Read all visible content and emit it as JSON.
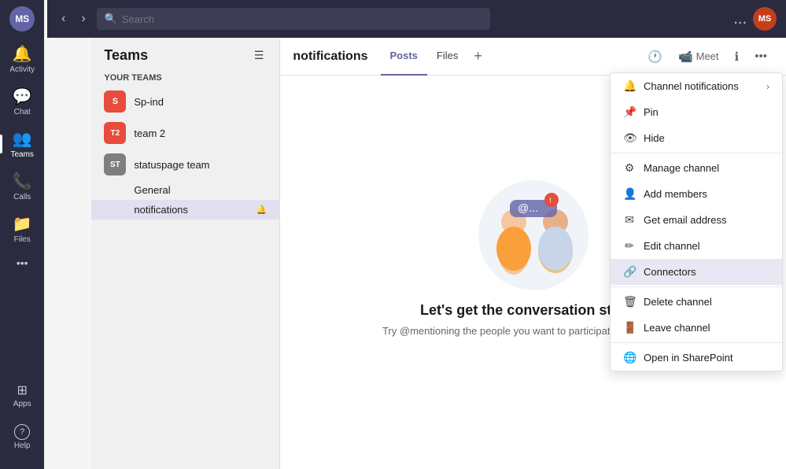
{
  "app": {
    "title": "Teams"
  },
  "topbar": {
    "search_placeholder": "Search",
    "dots_label": "...",
    "user_initials": "MS"
  },
  "sidebar": {
    "items": [
      {
        "id": "activity",
        "label": "Activity",
        "icon": "🔔"
      },
      {
        "id": "chat",
        "label": "Chat",
        "icon": "💬"
      },
      {
        "id": "teams",
        "label": "Teams",
        "icon": "👥"
      },
      {
        "id": "calls",
        "label": "Calls",
        "icon": "📞"
      },
      {
        "id": "files",
        "label": "Files",
        "icon": "📁"
      },
      {
        "id": "more",
        "label": "",
        "icon": "•••"
      }
    ],
    "bottom": [
      {
        "id": "apps",
        "label": "Apps",
        "icon": "⊞"
      },
      {
        "id": "help",
        "label": "Help",
        "icon": "?"
      }
    ]
  },
  "teams_panel": {
    "title": "Teams",
    "your_teams_label": "Your teams",
    "teams": [
      {
        "id": "sp-ind",
        "name": "Sp-ind",
        "initials": "S",
        "color": "#e74c3c",
        "channels": []
      },
      {
        "id": "team2",
        "name": "team 2",
        "initials": "T2",
        "color": "#e74c3c",
        "channels": []
      },
      {
        "id": "statuspage",
        "name": "statuspage team",
        "initials": "ST",
        "color": "#7e7e7e",
        "channels": [
          {
            "id": "general",
            "name": "General",
            "active": false
          },
          {
            "id": "notifications",
            "name": "notifications",
            "active": true,
            "has_icon": true
          }
        ]
      }
    ]
  },
  "channel": {
    "name": "notifications",
    "tabs": [
      {
        "id": "posts",
        "label": "Posts",
        "active": true
      },
      {
        "id": "files",
        "label": "Files",
        "active": false
      }
    ],
    "header_buttons": [
      {
        "id": "meet",
        "label": "Meet",
        "icon": "📹"
      }
    ]
  },
  "empty_state": {
    "title": "Let's get the conversation started",
    "subtitle": "Try @mentioning the people you want to participate in this channel"
  },
  "dropdown_menu": {
    "items": [
      {
        "id": "channel-notifications",
        "label": "Channel notifications",
        "icon": "🔔",
        "has_arrow": true
      },
      {
        "id": "pin",
        "label": "Pin",
        "icon": "📌",
        "has_arrow": false
      },
      {
        "id": "hide",
        "label": "Hide",
        "icon": "👁",
        "has_arrow": false
      },
      {
        "id": "manage-channel",
        "label": "Manage channel",
        "icon": "⚙",
        "has_arrow": false
      },
      {
        "id": "add-members",
        "label": "Add members",
        "icon": "👤",
        "has_arrow": false
      },
      {
        "id": "get-email",
        "label": "Get email address",
        "icon": "✉",
        "has_arrow": false
      },
      {
        "id": "edit-channel",
        "label": "Edit channel",
        "icon": "✏",
        "has_arrow": false
      },
      {
        "id": "connectors",
        "label": "Connectors",
        "icon": "🔗",
        "has_arrow": false,
        "highlighted": true
      },
      {
        "id": "delete-channel",
        "label": "Delete channel",
        "icon": "🗑",
        "has_arrow": false
      },
      {
        "id": "leave-channel",
        "label": "Leave channel",
        "icon": "🚪",
        "has_arrow": false
      },
      {
        "id": "open-sharepoint",
        "label": "Open in SharePoint",
        "icon": "🌐",
        "has_arrow": false
      }
    ]
  }
}
